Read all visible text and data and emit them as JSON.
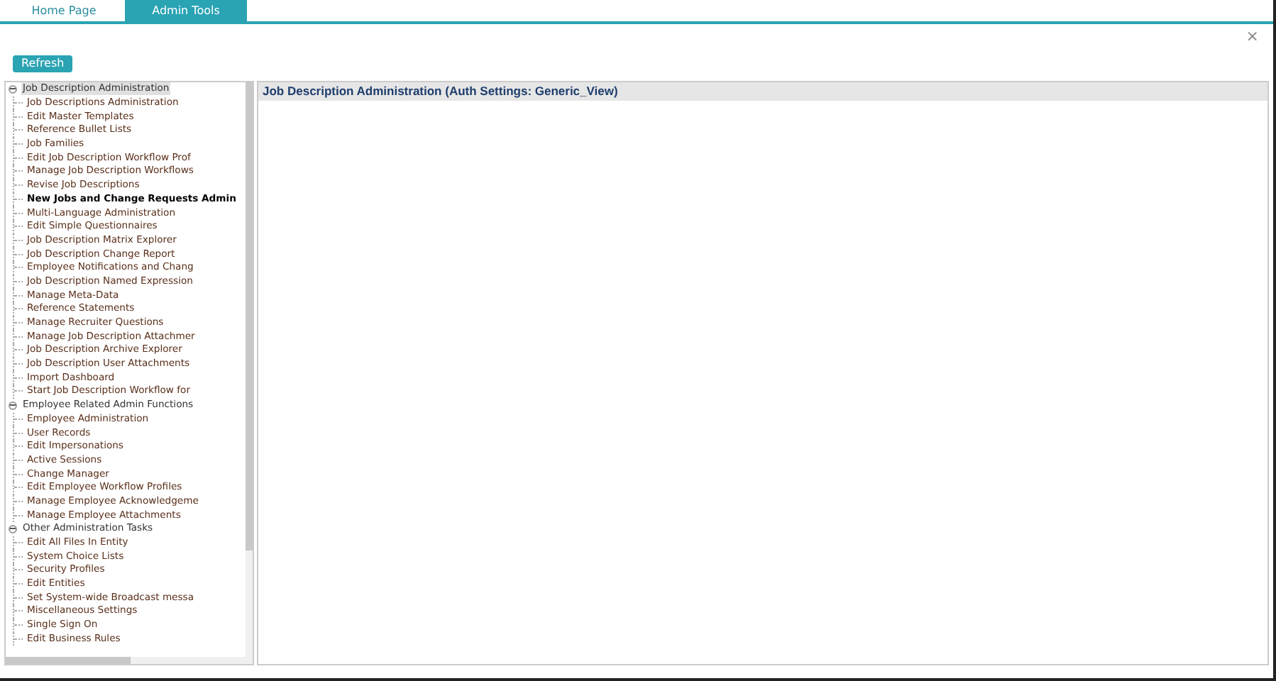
{
  "tabs": [
    {
      "label": "Home Page",
      "selected": false
    },
    {
      "label": "Admin Tools",
      "selected": true
    }
  ],
  "close": "×",
  "refresh_button": "Refresh",
  "tree": [
    {
      "label": "Job Description Administration",
      "expanded": true,
      "selected": true,
      "children": [
        {
          "label": "Job Descriptions Administration",
          "current": false
        },
        {
          "label": "Edit Master Templates",
          "current": false
        },
        {
          "label": "Reference Bullet Lists",
          "current": false
        },
        {
          "label": "Job Families",
          "current": false
        },
        {
          "label": "Edit Job Description Workflow Prof",
          "current": false
        },
        {
          "label": "Manage Job Description Workflows",
          "current": false
        },
        {
          "label": "Revise Job Descriptions",
          "current": false
        },
        {
          "label": "New Jobs and Change Requests Admin",
          "current": true
        },
        {
          "label": "Multi-Language Administration",
          "current": false
        },
        {
          "label": "Edit Simple Questionnaires",
          "current": false
        },
        {
          "label": "Job Description Matrix Explorer",
          "current": false
        },
        {
          "label": "Job Description Change Report",
          "current": false
        },
        {
          "label": "Employee Notifications and Chang",
          "current": false
        },
        {
          "label": "Job Description Named Expression",
          "current": false
        },
        {
          "label": "Manage Meta-Data",
          "current": false
        },
        {
          "label": "Reference Statements",
          "current": false
        },
        {
          "label": "Manage Recruiter Questions",
          "current": false
        },
        {
          "label": "Manage Job Description Attachmer",
          "current": false
        },
        {
          "label": "Job Description Archive Explorer",
          "current": false
        },
        {
          "label": "Job Description User Attachments",
          "current": false
        },
        {
          "label": "Import Dashboard",
          "current": false
        },
        {
          "label": "Start Job Description Workflow for",
          "current": false
        }
      ]
    },
    {
      "label": "Employee Related Admin Functions",
      "expanded": true,
      "selected": false,
      "children": [
        {
          "label": "Employee Administration",
          "current": false
        },
        {
          "label": "User Records",
          "current": false
        },
        {
          "label": "Edit Impersonations",
          "current": false
        },
        {
          "label": "Active Sessions",
          "current": false
        },
        {
          "label": "Change Manager",
          "current": false
        },
        {
          "label": "Edit Employee Workflow Profiles",
          "current": false
        },
        {
          "label": "Manage Employee Acknowledgeme",
          "current": false
        },
        {
          "label": "Manage Employee Attachments",
          "current": false
        }
      ]
    },
    {
      "label": "Other Administration Tasks",
      "expanded": true,
      "selected": false,
      "children": [
        {
          "label": "Edit All Files In Entity",
          "current": false
        },
        {
          "label": "System Choice Lists",
          "current": false
        },
        {
          "label": "Security Profiles",
          "current": false
        },
        {
          "label": "Edit Entities",
          "current": false
        },
        {
          "label": "Set System-wide Broadcast messa",
          "current": false
        },
        {
          "label": "Miscellaneous Settings",
          "current": false
        },
        {
          "label": "Single Sign On",
          "current": false
        },
        {
          "label": "Edit Business Rules",
          "current": false
        }
      ]
    }
  ],
  "content": {
    "title": "Job Description Administration (Auth Settings: Generic_View)"
  }
}
